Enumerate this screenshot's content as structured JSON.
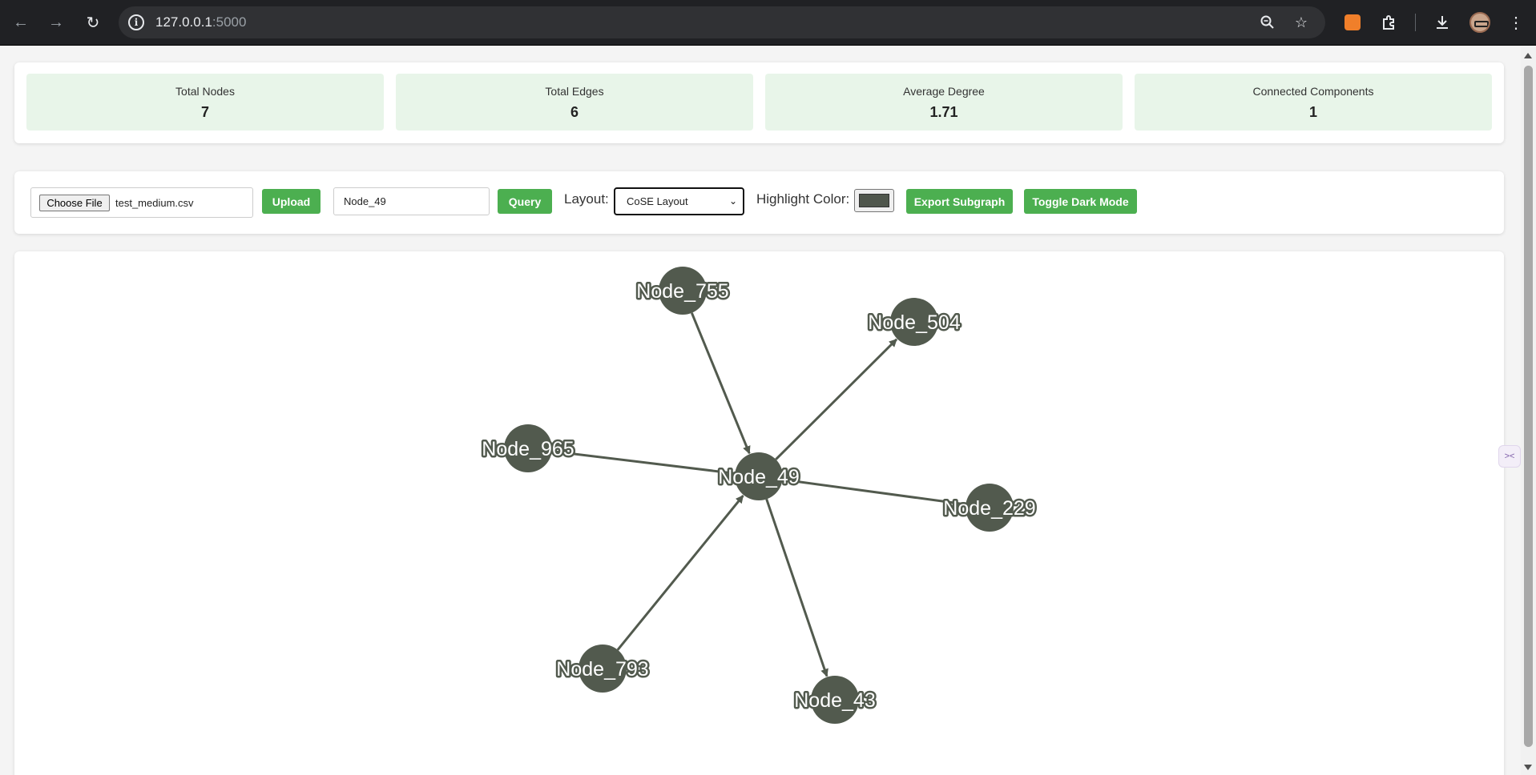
{
  "browser": {
    "url_host": "127.0.0.1",
    "url_port": ":5000",
    "icons": {
      "back": "arrow-left-icon",
      "forward": "arrow-right-icon",
      "reload": "reload-icon",
      "site_info": "info-icon",
      "zoom": "zoom-out-icon",
      "bookmark": "star-icon",
      "extension": "extension-icon",
      "puzzle": "puzzle-icon",
      "download": "download-icon",
      "menu": "kebab-menu-icon"
    }
  },
  "stats": {
    "total_nodes_label": "Total Nodes",
    "total_nodes_value": "7",
    "total_edges_label": "Total Edges",
    "total_edges_value": "6",
    "avg_degree_label": "Average Degree",
    "avg_degree_value": "1.71",
    "components_label": "Connected Components",
    "components_value": "1"
  },
  "controls": {
    "choose_file_label": "Choose File",
    "file_name": "test_medium.csv",
    "upload_label": "Upload",
    "query_value": "Node_49",
    "query_label": "Query",
    "layout_label": "Layout:",
    "layout_selected": "CoSE Layout",
    "highlight_label": "Highlight Color:",
    "highlight_color": "#4f564c",
    "export_label": "Export Subgraph",
    "dark_mode_label": "Toggle Dark Mode"
  },
  "graph": {
    "node_color": "#525a4e",
    "edge_color": "#525a4e",
    "nodes": [
      {
        "id": "Node_49",
        "label": "Node_49"
      },
      {
        "id": "Node_755",
        "label": "Node_755"
      },
      {
        "id": "Node_504",
        "label": "Node_504"
      },
      {
        "id": "Node_965",
        "label": "Node_965"
      },
      {
        "id": "Node_229",
        "label": "Node_229"
      },
      {
        "id": "Node_793",
        "label": "Node_793"
      },
      {
        "id": "Node_43",
        "label": "Node_43"
      }
    ],
    "edges": [
      {
        "source": "Node_755",
        "target": "Node_49",
        "directed": true
      },
      {
        "source": "Node_49",
        "target": "Node_504",
        "directed": true
      },
      {
        "source": "Node_965",
        "target": "Node_49",
        "directed": false
      },
      {
        "source": "Node_49",
        "target": "Node_229",
        "directed": false
      },
      {
        "source": "Node_793",
        "target": "Node_49",
        "directed": true
      },
      {
        "source": "Node_49",
        "target": "Node_43",
        "directed": true
      }
    ]
  }
}
